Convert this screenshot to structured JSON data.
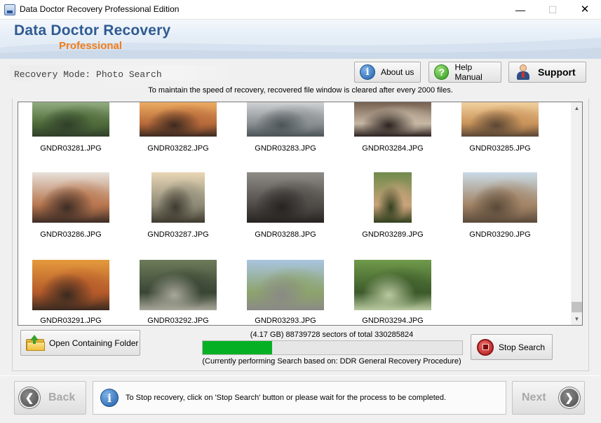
{
  "window": {
    "title": "Data Doctor Recovery Professional Edition",
    "minimize": "—",
    "maximize": "☐",
    "close": "✕"
  },
  "brand": {
    "line1": "Data Doctor Recovery",
    "line2": "Professional",
    "accent_blue": "#2f5b93",
    "accent_orange": "#f07c1a"
  },
  "mode": {
    "text": "Recovery Mode: Photo Search"
  },
  "header_buttons": {
    "about": "About us",
    "about_icon": "info-icon",
    "help": "Help Manual",
    "help_icon": "question-icon",
    "support": "Support",
    "support_icon": "person-icon"
  },
  "notice": "To maintain the speed of recovery, recovered file window is cleared after every 2000 files.",
  "files": [
    {
      "name": "GNDR03281.JPG",
      "colors": [
        "#9bb58a",
        "#4f6b3a",
        "#2f3f2a"
      ]
    },
    {
      "name": "GNDR03282.JPG",
      "colors": [
        "#f2b467",
        "#b86a3a",
        "#3c2a20"
      ]
    },
    {
      "name": "GNDR03283.JPG",
      "colors": [
        "#d8dadc",
        "#8a8f92",
        "#4c5458"
      ]
    },
    {
      "name": "GNDR03284.JPG",
      "colors": [
        "#6b5446",
        "#c7b8a4",
        "#2c2220"
      ]
    },
    {
      "name": "GNDR03285.JPG",
      "colors": [
        "#f7d9a7",
        "#c9935a",
        "#5a4634"
      ]
    },
    {
      "name": "GNDR03286.JPG",
      "colors": [
        "#e7e1d9",
        "#b8764f",
        "#3d2c25"
      ]
    },
    {
      "name": "GNDR03287.JPG",
      "colors": [
        "#e9d7b6",
        "#8d8a76",
        "#3f3a2f"
      ]
    },
    {
      "name": "GNDR03288.JPG",
      "colors": [
        "#8f8c88",
        "#4f4b47",
        "#262321"
      ]
    },
    {
      "name": "GNDR03289.JPG",
      "colors": [
        "#6f8a4a",
        "#c9a37b",
        "#32401f"
      ]
    },
    {
      "name": "GNDR03290.JPG",
      "colors": [
        "#c9dbe6",
        "#a38466",
        "#5a4a3a"
      ]
    },
    {
      "name": "GNDR03291.JPG",
      "colors": [
        "#e59a3c",
        "#b55a2a",
        "#3a2a20"
      ]
    },
    {
      "name": "GNDR03292.JPG",
      "colors": [
        "#6d7b5a",
        "#3a4634",
        "#a9a89a"
      ]
    },
    {
      "name": "GNDR03293.JPG",
      "colors": [
        "#a9c5e0",
        "#8da36c",
        "#8a8a86"
      ]
    },
    {
      "name": "GNDR03294.JPG",
      "colors": [
        "#6f9a4a",
        "#3c5a2a",
        "#b9c9a0"
      ]
    }
  ],
  "actions": {
    "open_folder": "Open Containing Folder",
    "stop_search": "Stop Search"
  },
  "progress": {
    "sectors_text": "(4.17 GB) 88739728  sectors  of  total 330285824",
    "fraction": 0.2687,
    "color": "#06b025",
    "status_text": "(Currently performing Search based on:  DDR General Recovery Procedure)"
  },
  "footer": {
    "back": "Back",
    "next": "Next",
    "info_text": "To Stop recovery, click on 'Stop Search' button or please wait for the process to be completed."
  }
}
